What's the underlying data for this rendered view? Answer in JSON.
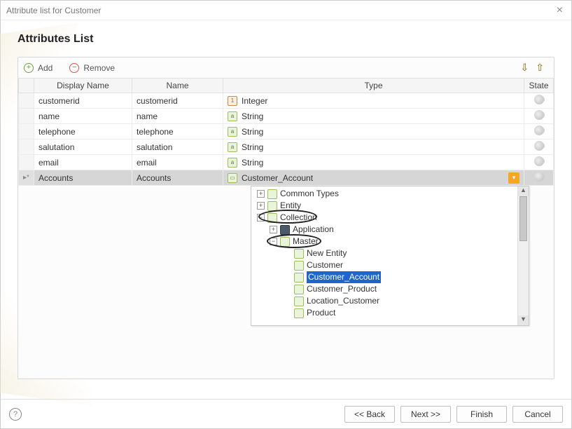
{
  "window": {
    "title": "Attribute list for Customer"
  },
  "heading": "Attributes List",
  "toolbar": {
    "add_label": "Add",
    "remove_label": "Remove"
  },
  "columns": {
    "display_name": "Display Name",
    "name": "Name",
    "type": "Type",
    "state": "State"
  },
  "rows": [
    {
      "display": "customerid",
      "name": "customerid",
      "type": "Integer",
      "type_kind": "int",
      "selected": false,
      "marker": ""
    },
    {
      "display": "name",
      "name": "name",
      "type": "String",
      "type_kind": "string",
      "selected": false,
      "marker": ""
    },
    {
      "display": "telephone",
      "name": "telephone",
      "type": "String",
      "type_kind": "string",
      "selected": false,
      "marker": ""
    },
    {
      "display": "salutation",
      "name": "salutation",
      "type": "String",
      "type_kind": "string",
      "selected": false,
      "marker": ""
    },
    {
      "display": "email",
      "name": "email",
      "type": "String",
      "type_kind": "string",
      "selected": false,
      "marker": ""
    },
    {
      "display": "Accounts",
      "name": "Accounts",
      "type": "Customer_Account",
      "type_kind": "entity",
      "selected": true,
      "marker": "▸*"
    }
  ],
  "tree": {
    "items": [
      {
        "indent": 0,
        "expander": "+",
        "icon": "entity",
        "label": "Common Types",
        "selected": false
      },
      {
        "indent": 0,
        "expander": "+",
        "icon": "entity",
        "label": "Entity",
        "selected": false
      },
      {
        "indent": 0,
        "expander": "−",
        "icon": "entity",
        "label": "Collection",
        "selected": false,
        "circled": true
      },
      {
        "indent": 1,
        "expander": "+",
        "icon": "app",
        "label": "Application",
        "selected": false
      },
      {
        "indent": 1,
        "expander": "−",
        "icon": "entity",
        "label": "Master",
        "selected": false,
        "circled": true
      },
      {
        "indent": 2,
        "expander": "",
        "icon": "entity",
        "label": "New Entity",
        "selected": false
      },
      {
        "indent": 2,
        "expander": "",
        "icon": "entity",
        "label": "Customer",
        "selected": false
      },
      {
        "indent": 2,
        "expander": "",
        "icon": "entity",
        "label": "Customer_Account",
        "selected": true
      },
      {
        "indent": 2,
        "expander": "",
        "icon": "entity",
        "label": "Customer_Product",
        "selected": false
      },
      {
        "indent": 2,
        "expander": "",
        "icon": "entity",
        "label": "Location_Customer",
        "selected": false
      },
      {
        "indent": 2,
        "expander": "",
        "icon": "entity",
        "label": "Product",
        "selected": false
      }
    ]
  },
  "footer": {
    "back": "<< Back",
    "next": "Next >>",
    "finish": "Finish",
    "cancel": "Cancel"
  }
}
